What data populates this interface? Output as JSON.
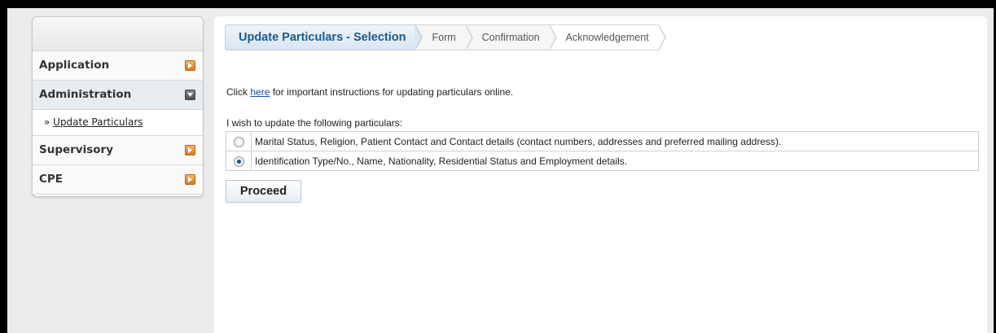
{
  "sidebar": {
    "items": [
      {
        "label": "Application"
      },
      {
        "label": "Administration"
      },
      {
        "label": "Supervisory"
      },
      {
        "label": "CPE"
      }
    ],
    "subitem": {
      "prefix": "» ",
      "label": "Update Particulars"
    }
  },
  "breadcrumb": {
    "steps": [
      "Update Particulars - Selection",
      "Form",
      "Confirmation",
      "Acknowledgement"
    ]
  },
  "main": {
    "instr_before": "Click ",
    "instr_link": "here",
    "instr_after": " for important instructions for updating particulars online.",
    "wish_label": "I wish to update the following particulars:",
    "options": [
      {
        "label": "Marital Status, Religion, Patient Contact and Contact details (contact numbers, addresses and preferred mailing address).",
        "selected": false
      },
      {
        "label": "Identification Type/No., Name, Nationality, Residential Status and Employment details.",
        "selected": true
      }
    ],
    "proceed_label": "Proceed"
  },
  "colors": {
    "accent": "#1d5a8e",
    "link": "#1a4ea3",
    "arrow_orange": "#d77b21",
    "arrow_gray": "#4f4f4f"
  },
  "icons": {
    "collapsed": "arrow-right-icon",
    "expanded": "arrow-down-icon"
  }
}
